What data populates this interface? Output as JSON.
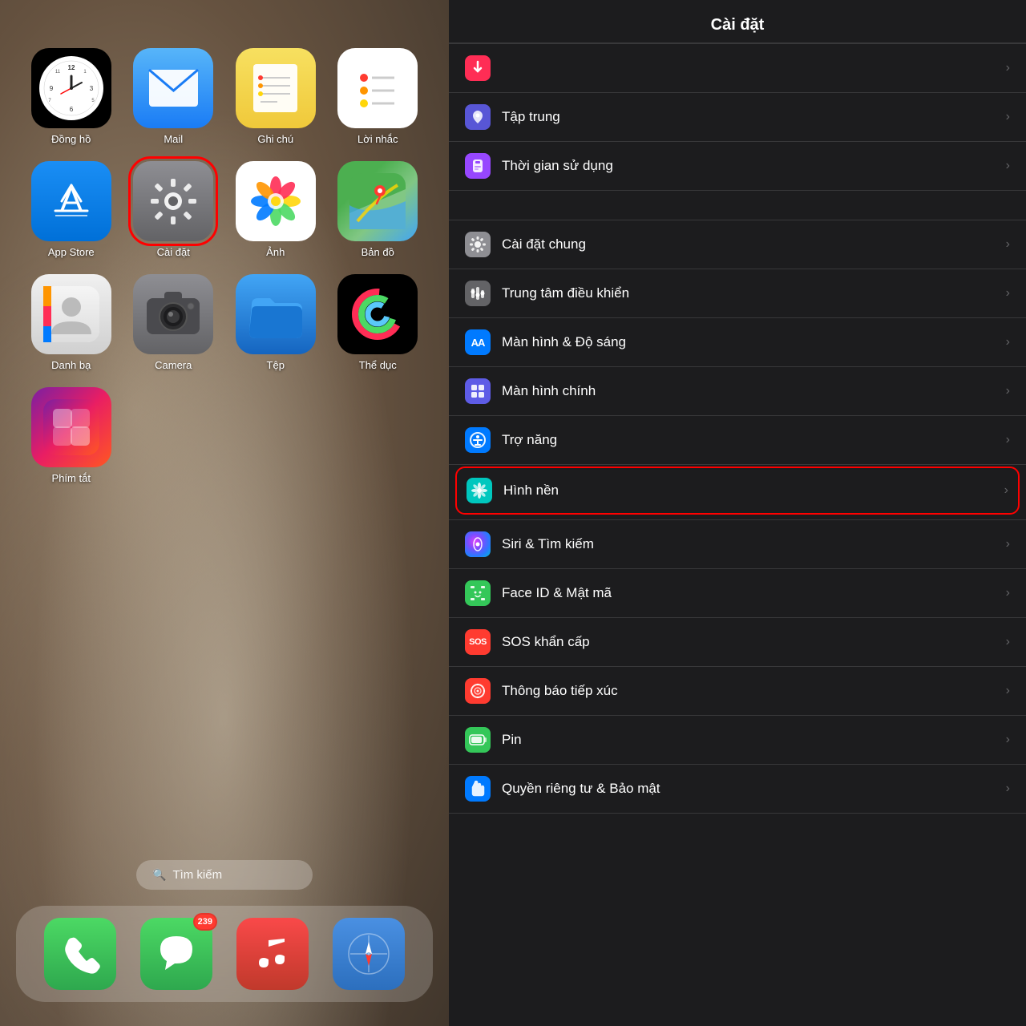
{
  "left": {
    "apps_row1": [
      {
        "id": "clock",
        "label": "Đồng hồ",
        "icon_type": "clock"
      },
      {
        "id": "mail",
        "label": "Mail",
        "icon_type": "mail"
      },
      {
        "id": "notes",
        "label": "Ghi chú",
        "icon_type": "notes"
      },
      {
        "id": "reminders",
        "label": "Lời nhắc",
        "icon_type": "reminders"
      }
    ],
    "apps_row2": [
      {
        "id": "appstore",
        "label": "App Store",
        "icon_type": "appstore"
      },
      {
        "id": "settings",
        "label": "Cài đặt",
        "icon_type": "settings",
        "highlighted": true
      },
      {
        "id": "photos",
        "label": "Ảnh",
        "icon_type": "photos"
      },
      {
        "id": "maps",
        "label": "Bản đồ",
        "icon_type": "maps"
      }
    ],
    "apps_row3": [
      {
        "id": "contacts",
        "label": "Danh bạ",
        "icon_type": "contacts"
      },
      {
        "id": "camera",
        "label": "Camera",
        "icon_type": "camera"
      },
      {
        "id": "files",
        "label": "Tệp",
        "icon_type": "files"
      },
      {
        "id": "fitness",
        "label": "Thể dục",
        "icon_type": "fitness"
      }
    ],
    "apps_row4": [
      {
        "id": "shortcuts",
        "label": "Phím tắt",
        "icon_type": "shortcuts"
      }
    ],
    "search_placeholder": "Tìm kiếm",
    "dock": [
      {
        "id": "phone",
        "label": "Phone",
        "icon_type": "phone"
      },
      {
        "id": "messages",
        "label": "Messages",
        "icon_type": "messages",
        "badge": "239"
      },
      {
        "id": "music",
        "label": "Music",
        "icon_type": "music"
      },
      {
        "id": "safari",
        "label": "Safari",
        "icon_type": "safari"
      }
    ]
  },
  "right": {
    "title": "Cài đặt",
    "top_partial_label": "",
    "items": [
      {
        "id": "tap-trung",
        "label": "Tập trung",
        "icon_color": "bg-purple-dark",
        "icon_emoji": "🌙",
        "highlighted": false
      },
      {
        "id": "thoi-gian",
        "label": "Thời gian sử dụng",
        "icon_color": "bg-purple",
        "icon_emoji": "⏳",
        "highlighted": false
      },
      {
        "id": "cai-dat-chung",
        "label": "Cài đặt chung",
        "icon_color": "bg-gray",
        "icon_emoji": "⚙️",
        "highlighted": false
      },
      {
        "id": "trung-tam",
        "label": "Trung tâm điều khiển",
        "icon_color": "bg-dark-gray",
        "icon_emoji": "🎛",
        "highlighted": false
      },
      {
        "id": "man-hinh-sang",
        "label": "Màn hình & Độ sáng",
        "icon_color": "bg-blue",
        "icon_emoji": "AA",
        "highlighted": false
      },
      {
        "id": "man-hinh-chinh",
        "label": "Màn hình chính",
        "icon_color": "bg-indigo",
        "icon_emoji": "▦",
        "highlighted": false
      },
      {
        "id": "tro-nang",
        "label": "Trợ năng",
        "icon_color": "bg-blue",
        "icon_emoji": "♿",
        "highlighted": false
      },
      {
        "id": "hinh-nen",
        "label": "Hình nền",
        "icon_color": "bg-cyan",
        "icon_emoji": "❋",
        "highlighted": true
      },
      {
        "id": "siri",
        "label": "Siri & Tìm kiếm",
        "icon_color": "bg-dark-gray",
        "icon_emoji": "🔮",
        "highlighted": false
      },
      {
        "id": "face-id",
        "label": "Face ID & Mật mã",
        "icon_color": "bg-green",
        "icon_emoji": "🙂",
        "highlighted": false
      },
      {
        "id": "sos",
        "label": "SOS khẩn cấp",
        "icon_color": "bg-red",
        "icon_emoji": "SOS",
        "highlighted": false
      },
      {
        "id": "thong-bao",
        "label": "Thông báo tiếp xúc",
        "icon_color": "bg-red",
        "icon_emoji": "◉",
        "highlighted": false
      },
      {
        "id": "pin",
        "label": "Pin",
        "icon_color": "bg-green",
        "icon_emoji": "🔋",
        "highlighted": false
      },
      {
        "id": "quyen-rieng-tu",
        "label": "Quyền riêng tư & Bảo mật",
        "icon_color": "bg-blue",
        "icon_emoji": "✋",
        "highlighted": false
      }
    ]
  }
}
